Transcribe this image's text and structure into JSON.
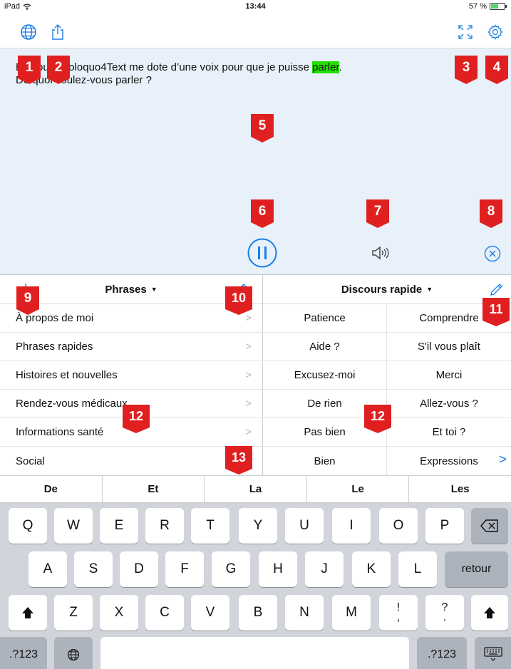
{
  "status_bar": {
    "device": "iPad",
    "time": "13:44",
    "battery": "57 %",
    "battery_level": 0.57
  },
  "toolbar": {
    "language_icon": "globe-icon",
    "share_icon": "share-icon",
    "fullscreen_icon": "fullscreen-icon",
    "settings_icon": "gear-icon"
  },
  "speech": {
    "line1_before": "Bonjour. Proloquo4Text me dote d’une voix pour que je puisse ",
    "line1_highlight": "parler",
    "line1_after": ".",
    "line2": "De quoi voulez-vous parler ?"
  },
  "controls": {
    "pause_icon": "pause-icon",
    "speak_icon": "speaker-icon",
    "clear_icon": "clear-icon"
  },
  "badges": [
    "1",
    "2",
    "3",
    "4",
    "5",
    "6",
    "7",
    "8",
    "9",
    "10",
    "11",
    "12",
    "12",
    "13"
  ],
  "phrases": {
    "title": "Phrases",
    "download_icon": "download-icon",
    "edit_icon": "pencil-icon",
    "items": [
      "À propos de moi",
      "Phrases rapides",
      "Histoires et nouvelles",
      "Rendez-vous médicaux",
      "Informations santé",
      "Social"
    ]
  },
  "quick_speech": {
    "title": "Discours rapide",
    "edit_icon": "pencil-icon",
    "items": [
      "Patience",
      "Comprendre",
      "Aide ?",
      "S'il vous plaît",
      "Excusez-moi",
      "Merci",
      "De rien",
      "Allez-vous ?",
      "Pas bien",
      "Et toi ?",
      "Bien",
      "Expressions"
    ]
  },
  "suggestions": [
    "De",
    "Et",
    "La",
    "Le",
    "Les"
  ],
  "keyboard": {
    "row1": [
      "Q",
      "W",
      "E",
      "R",
      "T",
      "Y",
      "U",
      "I",
      "O",
      "P"
    ],
    "row2": [
      "A",
      "S",
      "D",
      "F",
      "G",
      "H",
      "J",
      "K",
      "L"
    ],
    "row3": [
      "Z",
      "X",
      "C",
      "V",
      "B",
      "N",
      "M",
      "!\n,",
      "?\n."
    ],
    "return_label": "retour",
    "numbers_label": ".?123",
    "backspace_icon": "backspace-icon",
    "shift_icon": "shift-icon",
    "globe_icon": "globe-icon",
    "hide_keyboard_icon": "keyboard-hide-icon"
  },
  "colors": {
    "accent": "#1a7ee6",
    "highlight": "#22e000",
    "badge": "#e02020",
    "text_panel_bg": "#e8f0f9"
  }
}
